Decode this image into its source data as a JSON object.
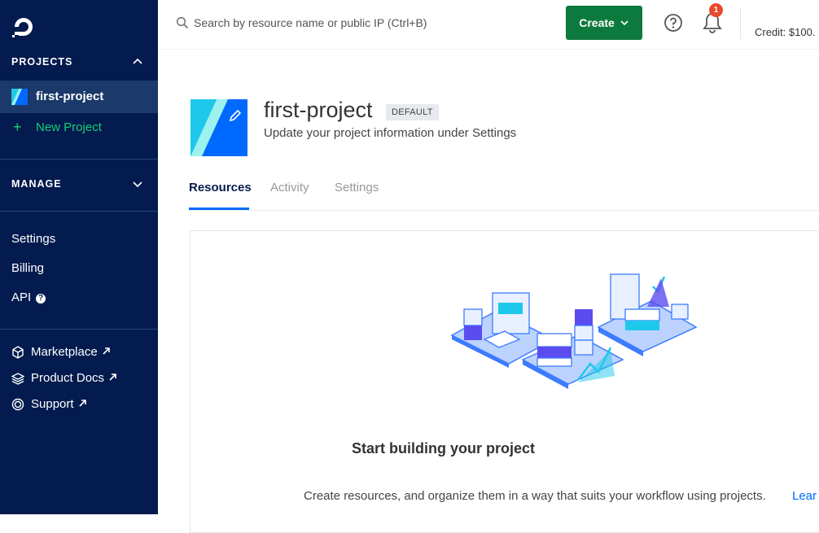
{
  "sidebar": {
    "projects_heading": "PROJECTS",
    "current_project": "first-project",
    "new_project_label": "New Project",
    "manage_heading": "MANAGE",
    "links": {
      "settings": "Settings",
      "billing": "Billing",
      "api": "API"
    },
    "api_badge": "?",
    "external": {
      "marketplace": "Marketplace",
      "product_docs": "Product Docs",
      "support": "Support"
    }
  },
  "topbar": {
    "search_placeholder": "Search by resource name or public IP (Ctrl+B)",
    "create_label": "Create",
    "notification_count": "1",
    "credit": "Credit: $100."
  },
  "project": {
    "title": "first-project",
    "badge": "DEFAULT",
    "subtitle": "Update your project information under Settings"
  },
  "tabs": {
    "resources": "Resources",
    "activity": "Activity",
    "settings": "Settings"
  },
  "empty_state": {
    "title": "Start building your project",
    "description": "Create resources, and organize them in a way that suits your workflow using projects.",
    "link": "Lear"
  },
  "colors": {
    "sidebar_bg": "#031b4e",
    "accent_green": "#15cd72",
    "create_button": "#0d7a3d",
    "brand_blue": "#0069ff",
    "notification_red": "#e84a2c"
  }
}
